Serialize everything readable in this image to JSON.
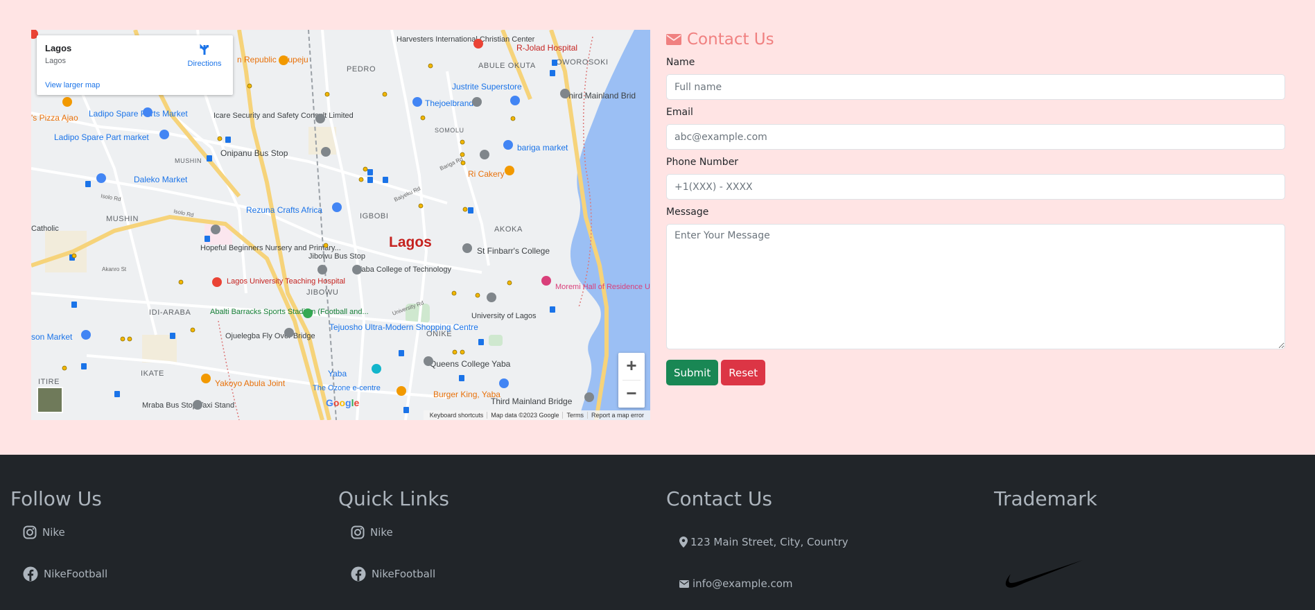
{
  "map": {
    "place_title": "Lagos",
    "place_subtitle": "Lagos",
    "directions_label": "Directions",
    "larger_map_link": "View larger map",
    "center_label": "Lagos",
    "zoom_in": "+",
    "zoom_out": "−",
    "google_logo": [
      "G",
      "o",
      "o",
      "g",
      "l",
      "e"
    ],
    "attribution": [
      "Keyboard shortcuts",
      "Map data ©2023 Google",
      "Terms",
      "Report a map error"
    ],
    "area_labels": [
      "PEDRO",
      "ABULE OKUTA",
      "OWOROSOKI",
      "SOMOLU",
      "MUSHIN",
      "IGBOBI",
      "AKOKA",
      "JIBOWU",
      "IDI-ARABA",
      "ONIKE",
      "IKATE",
      "ITIRE"
    ],
    "poi_labels": {
      "harvesters": "Harvesters International Christian Center",
      "jolad": "R-Jolad Hospital",
      "justrite": "Justrite Superstore",
      "thejoelbrand": "Thejoelbrand",
      "third_mainland": "Third Mainland Brid",
      "ladipo_spare_market": "Ladipo Spare Parts Market",
      "ladipo_spare_part": "Ladipo Spare Part market",
      "icare": "Icare Security and Safety Consult Limited",
      "onipanu": "Onipanu Bus Stop",
      "bariga": "bariga market",
      "dlaleko": "Daleko Market",
      "ri_cakery": "Ri Cakery",
      "rezuna": "Rezuna Crafts Africa",
      "hopeful": "Hopeful Beginners Nursery and Primary...",
      "jibowu_bus": "Jibowu Bus Stop",
      "yaba_college": "Yaba College of Technology",
      "st_finbarr": "St Finbarr's College",
      "luth": "Lagos University Teaching Hospital",
      "moremi": "Moremi Hall of Residence UNILAG...",
      "abalti": "Abalti Barracks Sports Stadium (Football and...",
      "unilag": "University of Lagos",
      "ojuelegba": "Ojuelegba Fly Over Bridge",
      "tejuosho": "Tejuosho Ultra-Modern Shopping Centre",
      "yakoyo": "Yakoyo Abula Joint",
      "queens": "Queens College Yaba",
      "ozone": "The Ozone e-centre",
      "burger": "Burger King, Yaba",
      "third_mainland_2": "Third Mainland Bridge",
      "mraba": "Mraba Bus Stop Taxi Stand",
      "pizza": "'s Pizza Ajao",
      "republic": "n Republic - Ilupeju",
      "son_market": "son Market",
      "yaba": "Yaba",
      "akanro": "Akanro St",
      "isolo": "Isolo Rd",
      "isolo2": "Isolo Rd",
      "university_rd": "University Rd",
      "baiyeku": "Baiyeku Rd",
      "bariga_rd": "Bariga Rd",
      "mushin2": "MUSHIN",
      "catholic": "Catholic"
    }
  },
  "form": {
    "title": "Contact Us",
    "name_label": "Name",
    "name_placeholder": "Full name",
    "email_label": "Email",
    "email_placeholder": "abc@example.com",
    "phone_label": "Phone Number",
    "phone_placeholder": "+1(XXX) - XXXX",
    "message_label": "Message",
    "message_placeholder": "Enter Your Message",
    "submit_label": "Submit",
    "reset_label": "Reset"
  },
  "footer": {
    "follow": {
      "heading": "Follow Us",
      "items": [
        {
          "label": "Nike",
          "icon": "instagram-icon"
        },
        {
          "label": "NikeFootball",
          "icon": "facebook-icon"
        }
      ]
    },
    "quick": {
      "heading": "Quick Links",
      "items": [
        {
          "label": "Nike",
          "icon": "instagram-icon"
        },
        {
          "label": "NikeFootball",
          "icon": "facebook-icon"
        }
      ]
    },
    "contact": {
      "heading": "Contact Us",
      "items": [
        {
          "label": "123 Main Street, City, Country",
          "icon": "location-pin-icon"
        },
        {
          "label": "info@example.com",
          "icon": "envelope-icon"
        }
      ]
    },
    "trademark": {
      "heading": "Trademark",
      "logo": "nike-swoosh-logo"
    }
  },
  "colors": {
    "page_bg": "#ffe4e4",
    "footer_bg": "#212529",
    "footer_text": "#adb5bd",
    "title_accent": "#f08080",
    "submit": "#198754",
    "reset": "#dc3545"
  }
}
